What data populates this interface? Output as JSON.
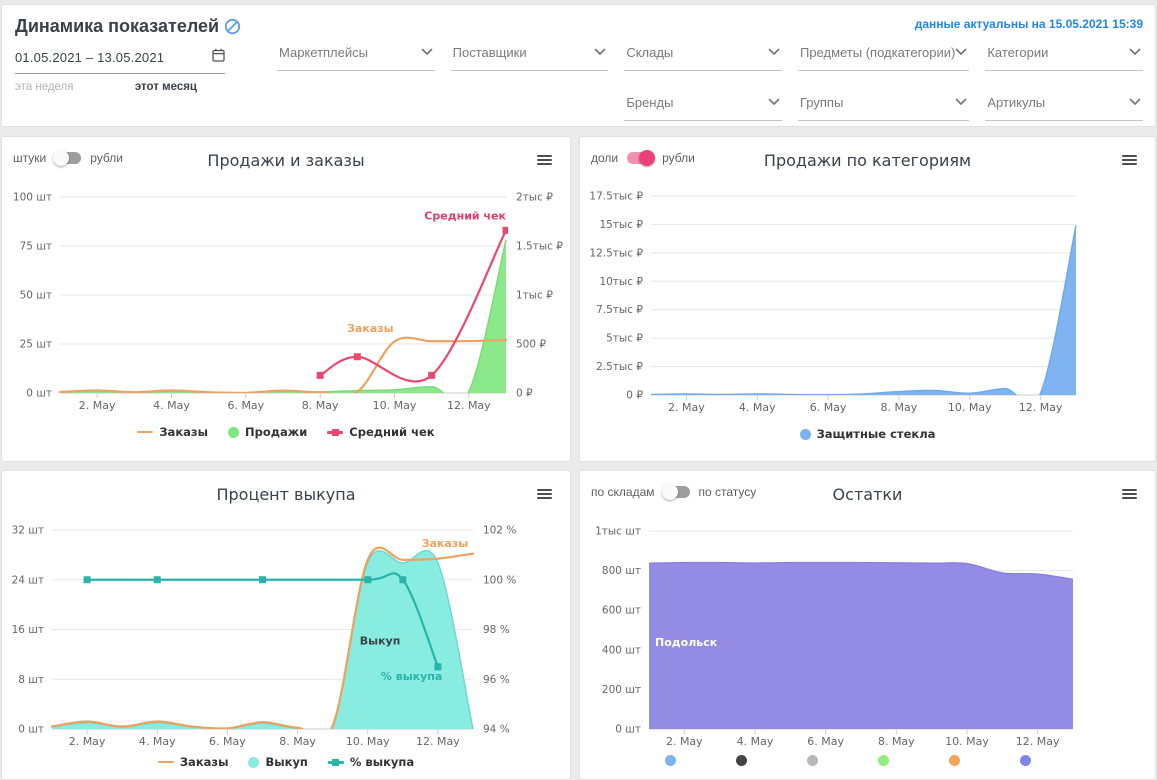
{
  "header": {
    "title": "Динамика показателей",
    "updated": "данные актуальны на 15.05.2021 15:39",
    "date_range": "01.05.2021 – 13.05.2021",
    "presets": {
      "week": "эта неделя",
      "month": "этот месяц"
    },
    "filters_row1": [
      "Маркетплейсы",
      "Поставщики",
      "Склады",
      "Предметы (подкатегории)",
      "Категории"
    ],
    "filters_row2": [
      "Бренды",
      "Группы",
      "Артикулы"
    ]
  },
  "chart_data": [
    {
      "type": "area",
      "title": "Продажи и заказы",
      "toggle": {
        "left": "штуки",
        "right": "рубли",
        "variant": "grey",
        "active": "left"
      },
      "x": {
        "min": 1,
        "max": 13,
        "ticks": [
          {
            "v": 2,
            "label": "2. May"
          },
          {
            "v": 4,
            "label": "4. May"
          },
          {
            "v": 6,
            "label": "6. May"
          },
          {
            "v": 8,
            "label": "8. May"
          },
          {
            "v": 10,
            "label": "10. May"
          },
          {
            "v": 12,
            "label": "12. May"
          }
        ]
      },
      "axes": {
        "left": {
          "min": 0,
          "max": 100,
          "ticks": [
            "0 шт",
            "25 шт",
            "50 шт",
            "75 шт",
            "100 шт"
          ]
        },
        "right": {
          "min": 0,
          "max": 2000,
          "ticks": [
            "0 ₽",
            "500 ₽",
            "1тыс ₽",
            "1.5тыс ₽",
            "2тыс ₽"
          ]
        }
      },
      "series": [
        {
          "name": "Заказы",
          "kind": "line",
          "axis": "left",
          "color": "#efa160",
          "values": [
            0.5,
            1.3,
            0.4,
            1.3,
            0.4,
            0.1,
            1.2,
            0.3,
            0.6,
            26.3,
            26.4,
            26.5,
            27
          ]
        },
        {
          "name": "Продажи",
          "kind": "area",
          "axis": "left",
          "color": "#77dd77",
          "fill": "#8be98b",
          "values": [
            0.4,
            1.0,
            0.3,
            0.9,
            0.3,
            0.1,
            0.9,
            0.6,
            1.2,
            1.6,
            3.2,
            0.8,
            78
          ]
        },
        {
          "name": "Средний чек",
          "kind": "line",
          "axis": "right",
          "color": "#e9486f",
          "marker": "square",
          "x": [
            8,
            9,
            11,
            13
          ],
          "values": [
            180,
            370,
            180,
            1660
          ]
        }
      ],
      "annotations": [
        {
          "text": "Заказы",
          "x": 9.35,
          "v": 31,
          "axis": "left",
          "color": "#efa160"
        },
        {
          "text": "Средний чек",
          "x": 11.9,
          "v": 1770,
          "axis": "right",
          "color": "#e73b66"
        }
      ],
      "legend": [
        {
          "label": "Заказы",
          "swatch": "line",
          "color": "#efa160"
        },
        {
          "label": "Продажи",
          "swatch": "dot",
          "color": "#7ce87c"
        },
        {
          "label": "Средний чек",
          "swatch": "line-square",
          "color": "#e9486f"
        }
      ]
    },
    {
      "type": "area",
      "title": "Продажи по категориям",
      "toggle": {
        "left": "доли",
        "right": "рубли",
        "variant": "pink",
        "active": "right"
      },
      "x": {
        "min": 1,
        "max": 13,
        "ticks": [
          {
            "v": 2,
            "label": "2. May"
          },
          {
            "v": 4,
            "label": "4. May"
          },
          {
            "v": 6,
            "label": "6. May"
          },
          {
            "v": 8,
            "label": "8. May"
          },
          {
            "v": 10,
            "label": "10. May"
          },
          {
            "v": 12,
            "label": "12. May"
          }
        ]
      },
      "axes": {
        "left": {
          "min": 0,
          "max": 17500,
          "ticks": [
            "0 ₽",
            "2.5тыс ₽",
            "5тыс ₽",
            "7.5тыс ₽",
            "10тыс ₽",
            "12.5тыс ₽",
            "15тыс ₽",
            "17.5тыс ₽"
          ]
        }
      },
      "series": [
        {
          "name": "Защитные стекла",
          "kind": "area",
          "axis": "left",
          "color": "#70a9ed",
          "fill": "#80b4f0",
          "values": [
            40,
            90,
            40,
            90,
            40,
            25,
            90,
            300,
            400,
            150,
            560,
            160,
            14900
          ]
        }
      ],
      "annotations": [],
      "legend": [
        {
          "label": "Защитные стекла",
          "swatch": "dot",
          "color": "#7cb0ef"
        }
      ]
    },
    {
      "type": "area",
      "title": "Процент выкупа",
      "x": {
        "min": 1,
        "max": 13,
        "ticks": [
          {
            "v": 2,
            "label": "2. May"
          },
          {
            "v": 4,
            "label": "4. May"
          },
          {
            "v": 6,
            "label": "6. May"
          },
          {
            "v": 8,
            "label": "8. May"
          },
          {
            "v": 10,
            "label": "10. May"
          },
          {
            "v": 12,
            "label": "12. May"
          }
        ]
      },
      "axes": {
        "left": {
          "min": 0,
          "max": 32,
          "ticks": [
            "0 шт",
            "8 шт",
            "16 шт",
            "24 шт",
            "32 шт"
          ]
        },
        "right": {
          "min": 94,
          "max": 102,
          "ticks": [
            "94 %",
            "96 %",
            "98 %",
            "100 %",
            "102 %"
          ]
        }
      },
      "series": [
        {
          "name": "Выкуп",
          "kind": "area",
          "axis": "left",
          "color": "#6fd9ce",
          "fill": "#89ece0",
          "values": [
            0.3,
            1.0,
            0.3,
            1.0,
            0.3,
            0.1,
            0.9,
            0.1,
            0.3,
            26.7,
            26.7,
            26.7,
            0
          ]
        },
        {
          "name": "Заказы",
          "kind": "line",
          "axis": "left",
          "color": "#efa160",
          "values": [
            0.4,
            1.2,
            0.4,
            1.2,
            0.4,
            0.1,
            1.1,
            0.2,
            0.5,
            27.2,
            27.2,
            27.4,
            28.2
          ]
        },
        {
          "name": "% выкупа",
          "kind": "line",
          "axis": "right",
          "color": "#2ab3a9",
          "marker": "square",
          "x": [
            2,
            4,
            7,
            10,
            11,
            12
          ],
          "values": [
            100,
            100,
            100,
            100,
            100,
            96.5
          ]
        }
      ],
      "annotations": [
        {
          "text": "Заказы",
          "x": 12.2,
          "v": 29.3,
          "axis": "left",
          "color": "#efa160"
        },
        {
          "text": "Выкуп",
          "x": 10.35,
          "v": 13.6,
          "axis": "left",
          "color": "#3b4149"
        },
        {
          "text": "% выкупа",
          "x": 11.25,
          "v": 7.9,
          "axis": "left",
          "color": "#2ab3a9"
        }
      ],
      "legend": [
        {
          "label": "Заказы",
          "swatch": "line",
          "color": "#efa160"
        },
        {
          "label": "Выкуп",
          "swatch": "dot",
          "color": "#89ece0"
        },
        {
          "label": "% выкупа",
          "swatch": "line-square",
          "color": "#2ab3a9"
        }
      ]
    },
    {
      "type": "area",
      "title": "Остатки",
      "toggle": {
        "left": "по складам",
        "right": "по статусу",
        "variant": "grey",
        "active": "left"
      },
      "x": {
        "min": 1,
        "max": 13,
        "ticks": [
          {
            "v": 2,
            "label": "2. May"
          },
          {
            "v": 4,
            "label": "4. May"
          },
          {
            "v": 6,
            "label": "6. May"
          },
          {
            "v": 8,
            "label": "8. May"
          },
          {
            "v": 10,
            "label": "10. May"
          },
          {
            "v": 12,
            "label": "12. May"
          }
        ]
      },
      "axes": {
        "left": {
          "min": 0,
          "max": 1000,
          "ticks": [
            "0 шт",
            "200 шт",
            "400 шт",
            "600 шт",
            "800 шт",
            "1тыс шт"
          ]
        }
      },
      "series": [
        {
          "name": "Подольск",
          "kind": "area",
          "axis": "left",
          "color": "#8a81df",
          "fill": "#938be4",
          "values": [
            837,
            840,
            840,
            838,
            840,
            840,
            840,
            839,
            837,
            835,
            788,
            782,
            756
          ]
        }
      ],
      "annotations": [
        {
          "text": "Подольск",
          "x": 2.05,
          "v": 420,
          "axis": "left",
          "color": "#ffffff"
        }
      ],
      "legend": [
        {
          "label": "",
          "swatch": "dot",
          "color": "#7cb5ec"
        },
        {
          "label": "",
          "swatch": "dot",
          "color": "#434348"
        },
        {
          "label": "",
          "swatch": "dot",
          "color": "#b8b8b8"
        },
        {
          "label": "",
          "swatch": "dot",
          "color": "#90ed7d"
        },
        {
          "label": "",
          "swatch": "dot",
          "color": "#f7a35c"
        },
        {
          "label": "",
          "swatch": "dot",
          "color": "#8085e9"
        }
      ]
    }
  ]
}
